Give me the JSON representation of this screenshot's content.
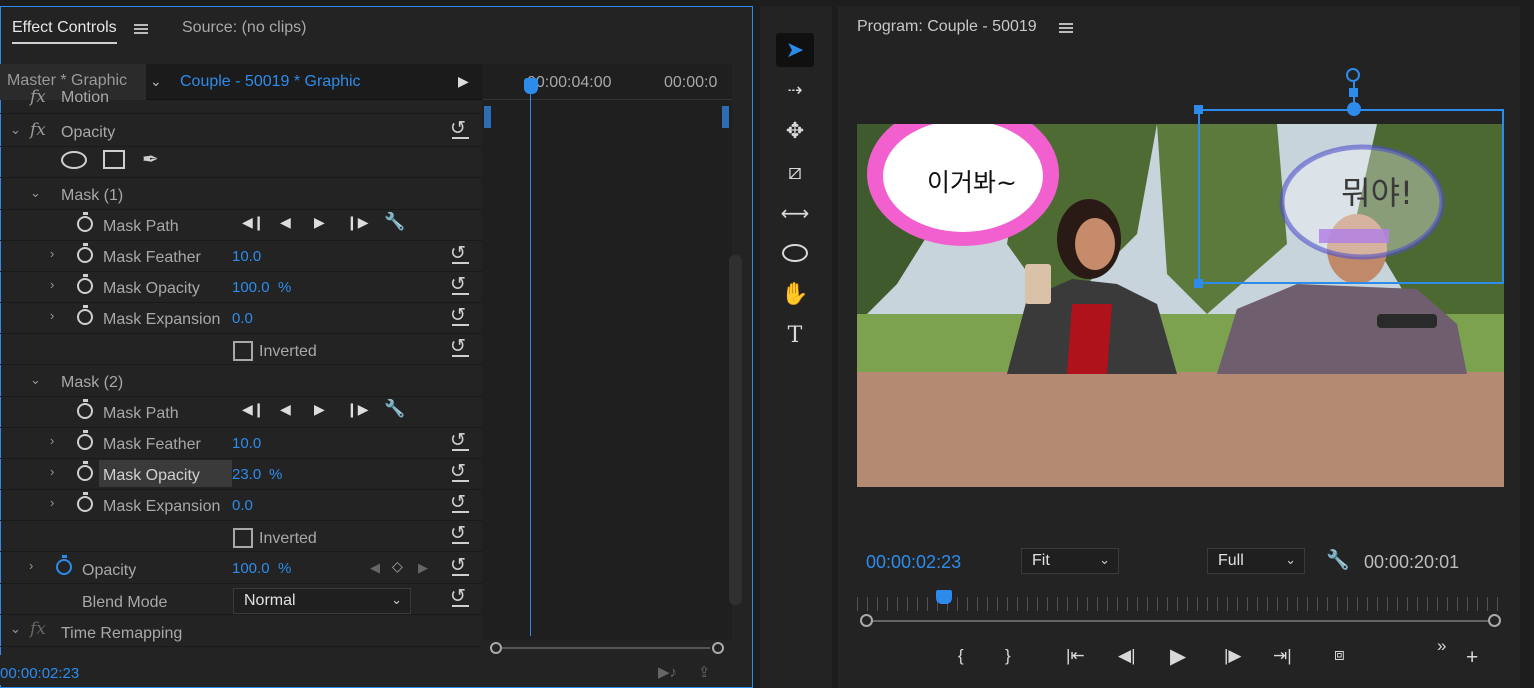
{
  "effect_controls": {
    "tab_active": "Effect Controls",
    "tab_source": "Source: (no clips)",
    "master_label": "Master * Graphic",
    "clip_label": "Couple - 50019 * Graphic",
    "ruler_time_1": "00:00:04:00",
    "ruler_time_2": "00:00:0",
    "motion_label": "Motion",
    "opacity_section": "Opacity",
    "mask1": {
      "title": "Mask (1)",
      "path_label": "Mask Path",
      "feather_label": "Mask Feather",
      "feather_value": "10.0",
      "opacity_label": "Mask Opacity",
      "opacity_value": "100.0",
      "opacity_unit": "%",
      "expansion_label": "Mask Expansion",
      "expansion_value": "0.0",
      "inverted_label": "Inverted"
    },
    "mask2": {
      "title": "Mask (2)",
      "path_label": "Mask Path",
      "feather_label": "Mask Feather",
      "feather_value": "10.0",
      "opacity_label": "Mask Opacity",
      "opacity_value": "23.0",
      "opacity_unit": "%",
      "expansion_label": "Mask Expansion",
      "expansion_value": "0.0",
      "inverted_label": "Inverted"
    },
    "opacity_prop_label": "Opacity",
    "opacity_prop_value": "100.0",
    "opacity_prop_unit": "%",
    "blend_label": "Blend Mode",
    "blend_value": "Normal",
    "time_remap_label": "Time Remapping",
    "footer_timecode": "00:00:02:23"
  },
  "program_monitor": {
    "title": "Program: Couple - 50019",
    "bubble_left_text": "이거봐~",
    "bubble_right_text": "뭐야!",
    "current_timecode": "00:00:02:23",
    "fit_value": "Fit",
    "resolution_value": "Full",
    "duration_timecode": "00:00:20:01"
  },
  "accent_color": "#2d8ceb",
  "icons": [
    "selection-tool-icon",
    "track-select-icon",
    "ripple-edit-icon",
    "razor-icon",
    "slip-icon",
    "ellipse-icon",
    "hand-icon",
    "type-icon"
  ]
}
